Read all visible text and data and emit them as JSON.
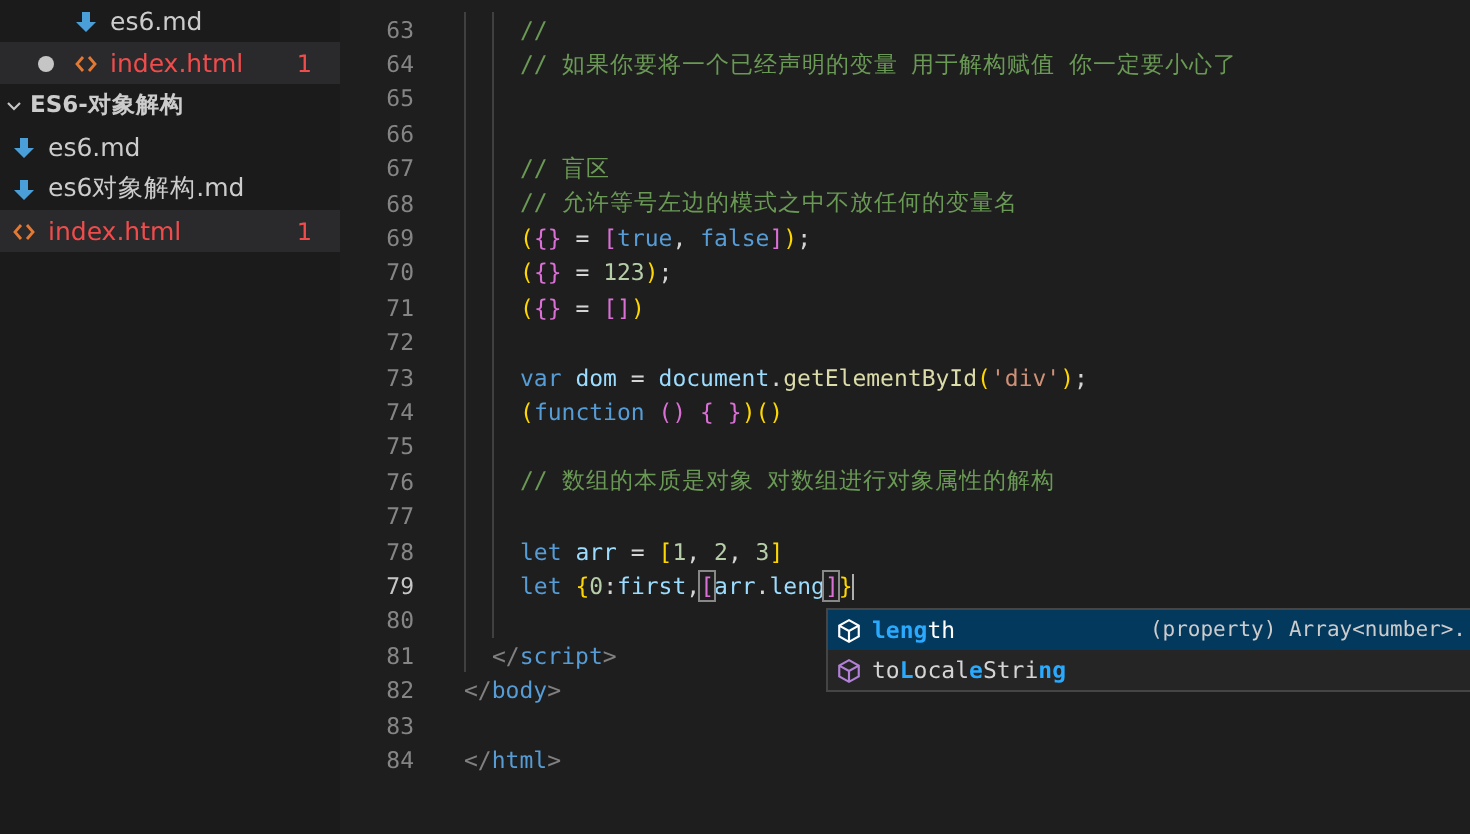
{
  "explorer": {
    "previous_folder_items": [
      {
        "name": "es6.md",
        "kind": "markdown",
        "modified": false,
        "selected": false
      },
      {
        "name": "index.html",
        "kind": "html",
        "modified": true,
        "selected": true,
        "problems": "1"
      }
    ],
    "folder": {
      "name": "ES6-对象解构",
      "expanded": true,
      "children": [
        {
          "name": "es6.md",
          "kind": "markdown",
          "modified": false,
          "selected": false
        },
        {
          "name": "es6对象解构.md",
          "kind": "markdown",
          "modified": false,
          "selected": false
        },
        {
          "name": "index.html",
          "kind": "html",
          "modified": false,
          "selected": true,
          "problems": "1"
        }
      ]
    }
  },
  "editor": {
    "lines": [
      {
        "number": "63",
        "current": false,
        "kind": "script-code",
        "tokens": [
          {
            "kind": "comment",
            "text": "//"
          }
        ]
      },
      {
        "number": "64",
        "current": false,
        "kind": "script-code",
        "tokens": [
          {
            "kind": "comment",
            "text": "// 如果你要将一个已经声明的变量 用于解构赋值 你一定要小心了"
          }
        ]
      },
      {
        "number": "65",
        "current": false,
        "kind": "script-code"
      },
      {
        "number": "66",
        "current": false,
        "kind": "script-code"
      },
      {
        "number": "67",
        "current": false,
        "kind": "script-code",
        "tokens": [
          {
            "kind": "comment",
            "text": "// 盲区"
          }
        ]
      },
      {
        "number": "68",
        "current": false,
        "kind": "script-code",
        "tokens": [
          {
            "kind": "comment",
            "text": "// 允许等号左边的模式之中不放任何的变量名"
          }
        ]
      },
      {
        "number": "69",
        "current": false,
        "kind": "script-code",
        "tokens": [
          {
            "kind": "bracket1",
            "text": "("
          },
          {
            "kind": "bracket2",
            "text": "{}"
          },
          {
            "kind": "plain",
            "text": " = "
          },
          {
            "kind": "bracket2",
            "text": "["
          },
          {
            "kind": "keyword",
            "text": "true"
          },
          {
            "kind": "plain",
            "text": ", "
          },
          {
            "kind": "keyword",
            "text": "false"
          },
          {
            "kind": "bracket2",
            "text": "]"
          },
          {
            "kind": "bracket1",
            "text": ")"
          },
          {
            "kind": "plain",
            "text": ";"
          }
        ]
      },
      {
        "number": "70",
        "current": false,
        "kind": "script-code",
        "tokens": [
          {
            "kind": "bracket1",
            "text": "("
          },
          {
            "kind": "bracket2",
            "text": "{}"
          },
          {
            "kind": "plain",
            "text": " = "
          },
          {
            "kind": "number",
            "text": "123"
          },
          {
            "kind": "bracket1",
            "text": ")"
          },
          {
            "kind": "plain",
            "text": ";"
          }
        ]
      },
      {
        "number": "71",
        "current": false,
        "kind": "script-code",
        "tokens": [
          {
            "kind": "bracket1",
            "text": "("
          },
          {
            "kind": "bracket2",
            "text": "{}"
          },
          {
            "kind": "plain",
            "text": " = "
          },
          {
            "kind": "bracket2",
            "text": "[]"
          },
          {
            "kind": "bracket1",
            "text": ")"
          }
        ]
      },
      {
        "number": "72",
        "current": false,
        "kind": "script-code"
      },
      {
        "number": "73",
        "current": false,
        "kind": "script-code",
        "tokens": [
          {
            "kind": "keyword",
            "text": "var "
          },
          {
            "kind": "variable",
            "text": "dom"
          },
          {
            "kind": "plain",
            "text": " = "
          },
          {
            "kind": "variable",
            "text": "document"
          },
          {
            "kind": "plain",
            "text": "."
          },
          {
            "kind": "function",
            "text": "getElementById"
          },
          {
            "kind": "bracket1",
            "text": "("
          },
          {
            "kind": "string",
            "text": "'div'"
          },
          {
            "kind": "bracket1",
            "text": ")"
          },
          {
            "kind": "plain",
            "text": ";"
          }
        ]
      },
      {
        "number": "74",
        "current": false,
        "kind": "script-code",
        "tokens": [
          {
            "kind": "bracket1",
            "text": "("
          },
          {
            "kind": "keyword",
            "text": "function "
          },
          {
            "kind": "bracket2",
            "text": "() "
          },
          {
            "kind": "bracket2",
            "text": "{ }"
          },
          {
            "kind": "bracket1",
            "text": ")()"
          }
        ]
      },
      {
        "number": "75",
        "current": false,
        "kind": "script-code"
      },
      {
        "number": "76",
        "current": false,
        "kind": "script-code",
        "tokens": [
          {
            "kind": "comment",
            "text": "// 数组的本质是对象 对数组进行对象属性的解构"
          }
        ]
      },
      {
        "number": "77",
        "current": false,
        "kind": "script-code"
      },
      {
        "number": "78",
        "current": false,
        "kind": "script-code",
        "tokens": [
          {
            "kind": "keyword",
            "text": "let "
          },
          {
            "kind": "variable",
            "text": "arr"
          },
          {
            "kind": "plain",
            "text": " = "
          },
          {
            "kind": "bracket1",
            "text": "["
          },
          {
            "kind": "number",
            "text": "1"
          },
          {
            "kind": "plain",
            "text": ", "
          },
          {
            "kind": "number",
            "text": "2"
          },
          {
            "kind": "plain",
            "text": ", "
          },
          {
            "kind": "number",
            "text": "3"
          },
          {
            "kind": "bracket1",
            "text": "]"
          }
        ]
      },
      {
        "number": "79",
        "current": true,
        "kind": "script-code",
        "tokens": [
          {
            "kind": "keyword",
            "text": "let "
          },
          {
            "kind": "bracket1",
            "text": "{"
          },
          {
            "kind": "number",
            "text": "0"
          },
          {
            "kind": "plain",
            "text": ":"
          },
          {
            "kind": "variable",
            "text": "first"
          },
          {
            "kind": "plain",
            "text": ","
          },
          {
            "kind": "bracket2",
            "text": "[",
            "boxed": true
          },
          {
            "kind": "variable",
            "text": "arr"
          },
          {
            "kind": "plain",
            "text": "."
          },
          {
            "kind": "variable",
            "text": "leng"
          },
          {
            "kind": "bracket2",
            "text": "]",
            "boxed": true
          },
          {
            "kind": "bracket1",
            "text": "}"
          }
        ]
      },
      {
        "number": "80",
        "current": false,
        "kind": "script-code"
      },
      {
        "number": "81",
        "current": false,
        "kind": "script-tag",
        "tokens": [
          {
            "kind": "tag",
            "text": "</"
          },
          {
            "kind": "tagname",
            "text": "script"
          },
          {
            "kind": "tag",
            "text": ">"
          }
        ]
      },
      {
        "number": "82",
        "current": false,
        "kind": "document",
        "tokens": [
          {
            "kind": "tag",
            "text": "</"
          },
          {
            "kind": "tagname",
            "text": "body"
          },
          {
            "kind": "tag",
            "text": ">"
          }
        ]
      },
      {
        "number": "83",
        "current": false,
        "kind": "document"
      },
      {
        "number": "84",
        "current": false,
        "kind": "document",
        "tokens": [
          {
            "kind": "tag",
            "text": "</"
          },
          {
            "kind": "tagname",
            "text": "html"
          },
          {
            "kind": "tag",
            "text": ">"
          }
        ]
      }
    ],
    "suggestions": [
      {
        "selected": true,
        "segments": [
          {
            "text": "leng",
            "match": true
          },
          {
            "text": "th",
            "match": false
          }
        ],
        "detail": "(property) Array<number>."
      },
      {
        "selected": false,
        "segments": [
          {
            "text": "to",
            "match": false
          },
          {
            "text": "L",
            "match": true
          },
          {
            "text": "ocal",
            "match": false
          },
          {
            "text": "e",
            "match": true
          },
          {
            "text": "Stri",
            "match": false
          },
          {
            "text": "ng",
            "match": true
          }
        ]
      }
    ]
  }
}
